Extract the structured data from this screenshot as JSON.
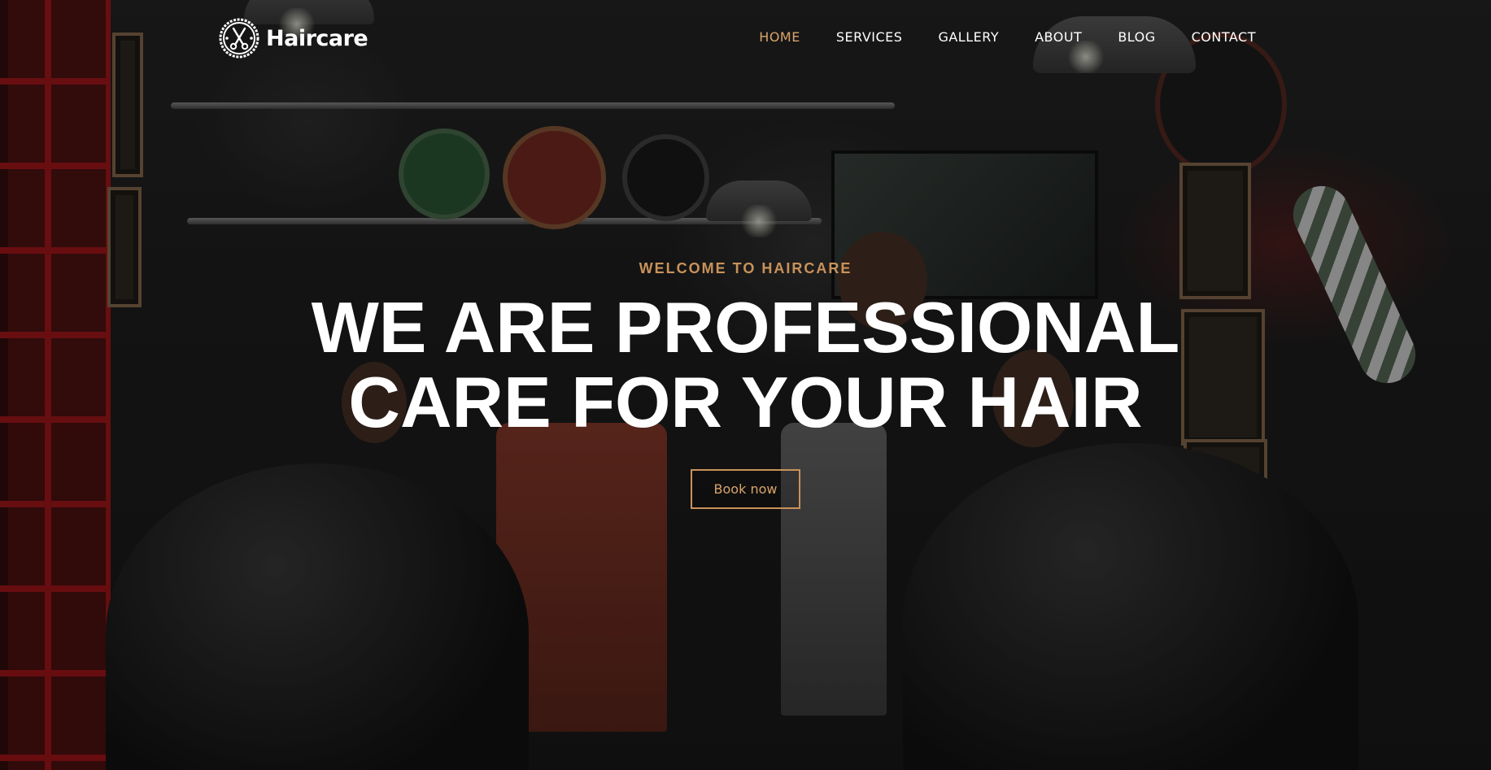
{
  "brand": {
    "name": "Haircare",
    "logo_icon": "scissors-badge-icon"
  },
  "nav": {
    "items": [
      {
        "label": "HOME",
        "active": true
      },
      {
        "label": "SERVICES",
        "active": false
      },
      {
        "label": "GALLERY",
        "active": false
      },
      {
        "label": "ABOUT",
        "active": false
      },
      {
        "label": "BLOG",
        "active": false
      },
      {
        "label": "CONTACT",
        "active": false
      }
    ]
  },
  "hero": {
    "kicker": "WELCOME TO HAIRCARE",
    "headline_line1": "WE ARE PROFESSIONAL",
    "headline_line2": "CARE FOR YOUR HAIR",
    "cta_label": "Book now"
  },
  "colors": {
    "accent": "#c9925a",
    "nav_active": "#d9a46b",
    "text": "#ffffff"
  }
}
